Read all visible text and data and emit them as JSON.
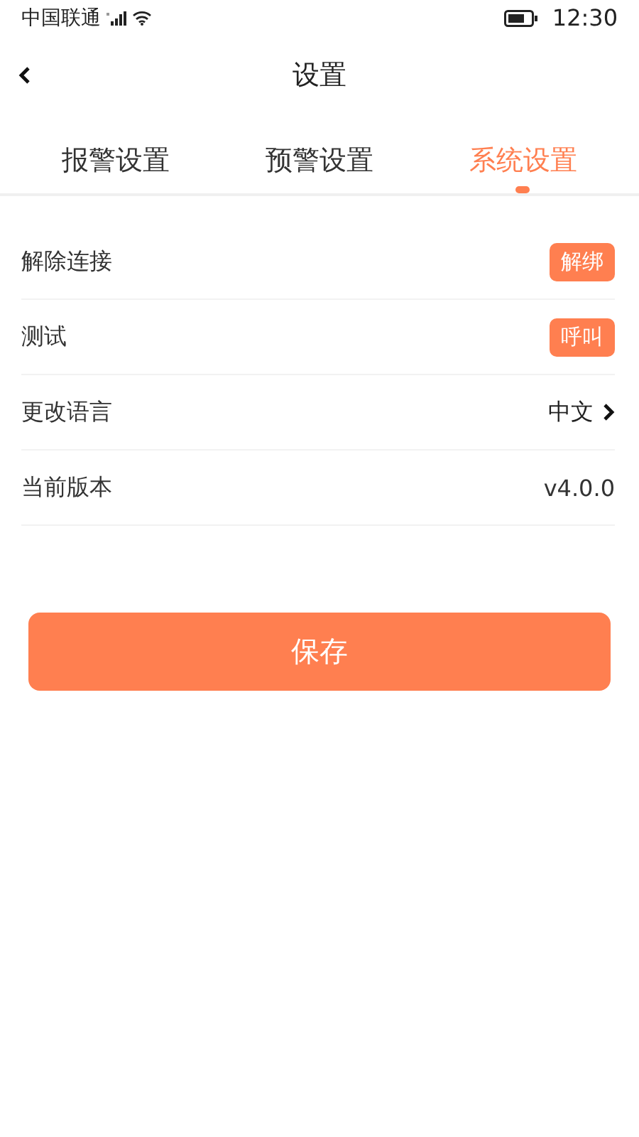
{
  "status_bar": {
    "carrier": "中国联通",
    "time": "12:30"
  },
  "header": {
    "title": "设置"
  },
  "tabs": [
    {
      "label": "报警设置",
      "selected": false
    },
    {
      "label": "预警设置",
      "selected": false
    },
    {
      "label": "系统设置",
      "selected": true
    }
  ],
  "rows": [
    {
      "kind": "button",
      "label": "解除连接",
      "value": "解绑"
    },
    {
      "kind": "button",
      "label": "测试",
      "value": "呼叫"
    },
    {
      "kind": "link",
      "label": "更改语言",
      "value": "中文"
    },
    {
      "kind": "value",
      "label": "当前版本",
      "value": "v4.0.0"
    }
  ],
  "save_button": "保存"
}
